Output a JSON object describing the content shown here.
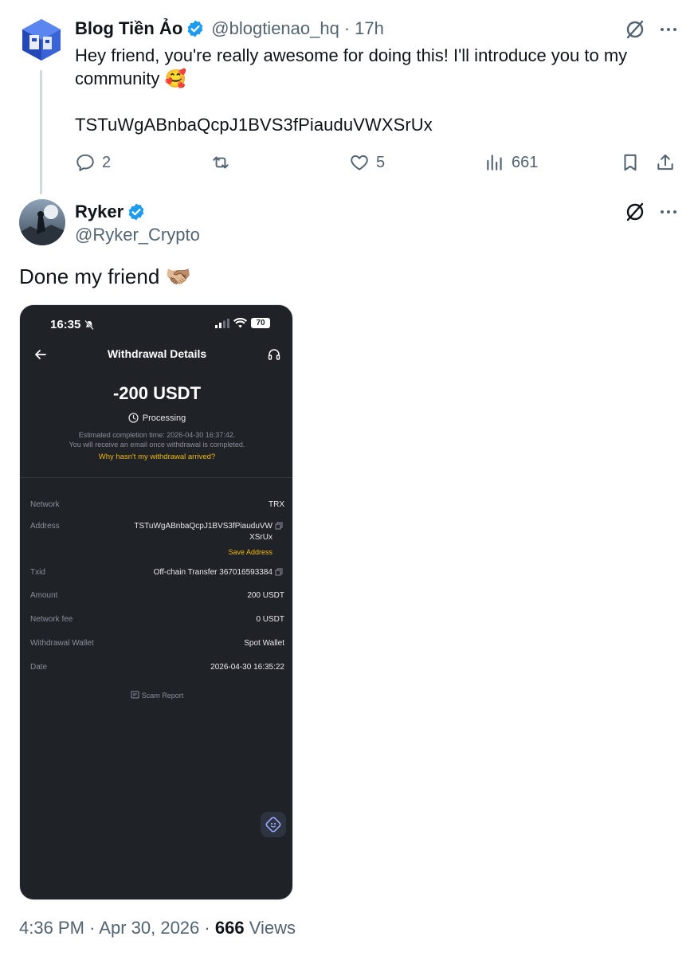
{
  "tweet_quoted": {
    "author_name": "Blog Tiền Ảo",
    "handle": "@blogtienao_hq",
    "separator": "·",
    "time": "17h",
    "text": "Hey friend, you're really awesome for doing this! I'll introduce you to my community 🥰",
    "address": "TSTuWgABnbaQcpJ1BVS3fPiauduVWXSrUx",
    "replies": "2",
    "reposts": "",
    "likes": "5",
    "views": "661"
  },
  "tweet_main": {
    "author_name": "Ryker",
    "handle": "@Ryker_Crypto",
    "text": "Done my friend 🫱🏼‍🫲🏽",
    "footer": {
      "time": "4:36 PM",
      "sep1": "·",
      "date": "Apr 30, 2026",
      "sep2": "·",
      "views_count": "666",
      "views_label": "Views"
    }
  },
  "screenshot": {
    "clock": "16:35",
    "battery": "70",
    "title": "Withdrawal Details",
    "amount": "-200 USDT",
    "status": "Processing",
    "note_line1": "Estimated completion time: 2026-04-30 16:37:42.",
    "note_line2": "You will receive an email once withdrawal is completed.",
    "why_link": "Why hasn't my withdrawal arrived?",
    "rows": {
      "network": {
        "label": "Network",
        "value": "TRX"
      },
      "address": {
        "label": "Address",
        "value_line1": "TSTuWgABnbaQcpJ1BVS3fPiauduVW",
        "value_line2": "XSrUx",
        "save": "Save Address"
      },
      "txid": {
        "label": "Txid",
        "value": "Off-chain Transfer 367016593384"
      },
      "amount": {
        "label": "Amount",
        "value": "200 USDT"
      },
      "fee": {
        "label": "Network fee",
        "value": "0 USDT"
      },
      "wallet": {
        "label": "Withdrawal Wallet",
        "value": "Spot Wallet"
      },
      "date": {
        "label": "Date",
        "value": "2026-04-30 16:35:22"
      }
    },
    "scam_report": "Scam Report"
  },
  "colors": {
    "verified": "#1d9bf0",
    "secondary_text": "#536471",
    "phone_bg": "#1f2227",
    "accent_yellow": "#f0b90b"
  },
  "icons": [
    "grok-icon",
    "more-icon",
    "reply-icon",
    "repost-icon",
    "like-icon",
    "views-icon",
    "bookmark-icon",
    "share-icon",
    "verified-badge-icon",
    "copy-icon",
    "headset-icon",
    "back-arrow-icon",
    "clock-icon"
  ]
}
